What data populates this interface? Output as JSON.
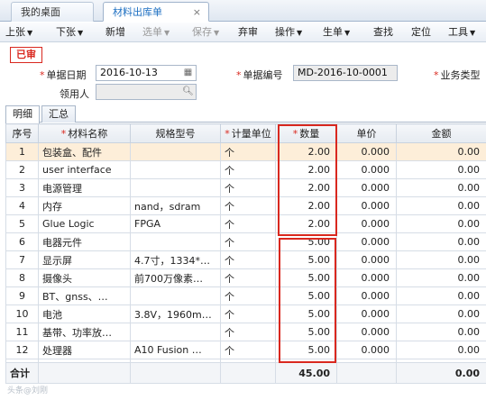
{
  "tabs": {
    "home": "我的桌面",
    "active": "材料出库单",
    "close": "×"
  },
  "toolbar": [
    {
      "label": "上张",
      "dropdown": true,
      "disabled": false
    },
    {
      "label": "下张",
      "dropdown": true,
      "disabled": false
    },
    {
      "label": "新增",
      "dropdown": false,
      "disabled": false
    },
    {
      "label": "选单",
      "dropdown": true,
      "disabled": true
    },
    {
      "label": "保存",
      "dropdown": true,
      "disabled": true
    },
    {
      "label": "弃审",
      "dropdown": false,
      "disabled": false
    },
    {
      "label": "操作",
      "dropdown": true,
      "disabled": false
    },
    {
      "label": "生单",
      "dropdown": true,
      "disabled": false
    },
    {
      "label": "查找",
      "dropdown": false,
      "disabled": false
    },
    {
      "label": "定位",
      "dropdown": false,
      "disabled": false
    },
    {
      "label": "工具",
      "dropdown": true,
      "disabled": false
    }
  ],
  "status_stamp": "已审",
  "form": {
    "date_label": "单据日期",
    "date_value": "2016-10-13",
    "number_label": "单据编号",
    "number_value": "MD-2016-10-0001",
    "biztype_label": "业务类型",
    "receiver_label": "领用人",
    "receiver_value": ""
  },
  "subtabs": [
    "明细",
    "汇总"
  ],
  "columns": [
    "序号",
    "材料名称",
    "规格型号",
    "计量单位",
    "数量",
    "单价",
    "金额"
  ],
  "required_columns": [
    1,
    3,
    4
  ],
  "rows": [
    {
      "no": "1",
      "name": "包装盒、配件",
      "spec": "",
      "unit": "个",
      "qty": "2.00",
      "price": "0.000",
      "amount": "0.00"
    },
    {
      "no": "2",
      "name": "user interface",
      "spec": "",
      "unit": "个",
      "qty": "2.00",
      "price": "0.000",
      "amount": "0.00"
    },
    {
      "no": "3",
      "name": "电源管理",
      "spec": "",
      "unit": "个",
      "qty": "2.00",
      "price": "0.000",
      "amount": "0.00"
    },
    {
      "no": "4",
      "name": "内存",
      "spec": "nand，sdram",
      "unit": "个",
      "qty": "2.00",
      "price": "0.000",
      "amount": "0.00"
    },
    {
      "no": "5",
      "name": "Glue Logic",
      "spec": "FPGA",
      "unit": "个",
      "qty": "2.00",
      "price": "0.000",
      "amount": "0.00"
    },
    {
      "no": "6",
      "name": "电器元件",
      "spec": "",
      "unit": "个",
      "qty": "5.00",
      "price": "0.000",
      "amount": "0.00"
    },
    {
      "no": "7",
      "name": "显示屏",
      "spec": "4.7寸，1334*…",
      "unit": "个",
      "qty": "5.00",
      "price": "0.000",
      "amount": "0.00"
    },
    {
      "no": "8",
      "name": "摄像头",
      "spec": "前700万像素…",
      "unit": "个",
      "qty": "5.00",
      "price": "0.000",
      "amount": "0.00"
    },
    {
      "no": "9",
      "name": "BT、gnss、…",
      "spec": "",
      "unit": "个",
      "qty": "5.00",
      "price": "0.000",
      "amount": "0.00"
    },
    {
      "no": "10",
      "name": "电池",
      "spec": "3.8V，1960m…",
      "unit": "个",
      "qty": "5.00",
      "price": "0.000",
      "amount": "0.00"
    },
    {
      "no": "11",
      "name": "基带、功率放…",
      "spec": "",
      "unit": "个",
      "qty": "5.00",
      "price": "0.000",
      "amount": "0.00"
    },
    {
      "no": "12",
      "name": "处理器",
      "spec": "A10 Fusion …",
      "unit": "个",
      "qty": "5.00",
      "price": "0.000",
      "amount": "0.00"
    }
  ],
  "selected_row": 0,
  "total": {
    "label": "合计",
    "qty": "45.00",
    "amount": "0.00"
  },
  "watermark": "头条@刘刚",
  "colors": {
    "accent": "#1d6fc2",
    "stamp": "#d9281f",
    "selected_row": "#fdeed9"
  }
}
